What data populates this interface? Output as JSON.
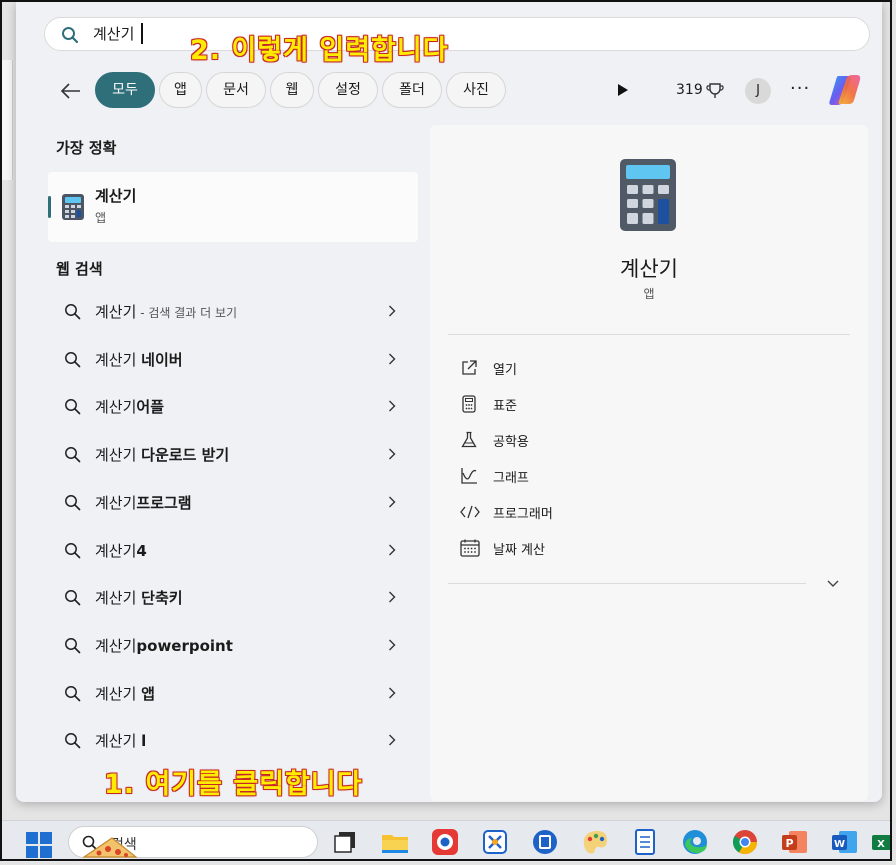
{
  "search": {
    "query": "계산기"
  },
  "annotations": {
    "top": "2. 이렇게 입력합니다",
    "bottom": "1. 여기를 클릭합니다"
  },
  "filters": [
    "모두",
    "앱",
    "문서",
    "웹",
    "설정",
    "폴더",
    "사진"
  ],
  "header": {
    "points": "319",
    "avatar_initial": "J",
    "more": "···"
  },
  "best_match": {
    "title": "가장 정확",
    "name": "계산기",
    "type": "앱"
  },
  "web_search": {
    "title": "웹 검색",
    "items": [
      {
        "prefix": "계산기",
        "bold": "",
        "hint": " - 검색 결과 더 보기"
      },
      {
        "prefix": "계산기 ",
        "bold": "네이버",
        "hint": ""
      },
      {
        "prefix": "계산기",
        "bold": "어플",
        "hint": ""
      },
      {
        "prefix": "계산기 ",
        "bold": "다운로드 받기",
        "hint": ""
      },
      {
        "prefix": "계산기",
        "bold": "프로그램",
        "hint": ""
      },
      {
        "prefix": "계산기",
        "bold": "4",
        "hint": ""
      },
      {
        "prefix": "계산기 ",
        "bold": "단축키",
        "hint": ""
      },
      {
        "prefix": "계산기",
        "bold": "powerpoint",
        "hint": ""
      },
      {
        "prefix": "계산기 ",
        "bold": "앱",
        "hint": ""
      },
      {
        "prefix": "계산기 ",
        "bold": "l",
        "hint": ""
      }
    ]
  },
  "detail": {
    "name": "계산기",
    "type": "앱",
    "actions": [
      {
        "label": "열기",
        "icon": "open-external-icon"
      },
      {
        "label": "표준",
        "icon": "calculator-standard-icon"
      },
      {
        "label": "공학용",
        "icon": "flask-icon"
      },
      {
        "label": "그래프",
        "icon": "graph-icon"
      },
      {
        "label": "프로그래머",
        "icon": "code-icon"
      },
      {
        "label": "날짜 계산",
        "icon": "calendar-icon"
      }
    ]
  },
  "taskbar": {
    "search_placeholder": "검색"
  },
  "colors": {
    "accent": "#2f6f7a",
    "annotation": "#ffec00",
    "annotation_outline": "#c62828"
  }
}
